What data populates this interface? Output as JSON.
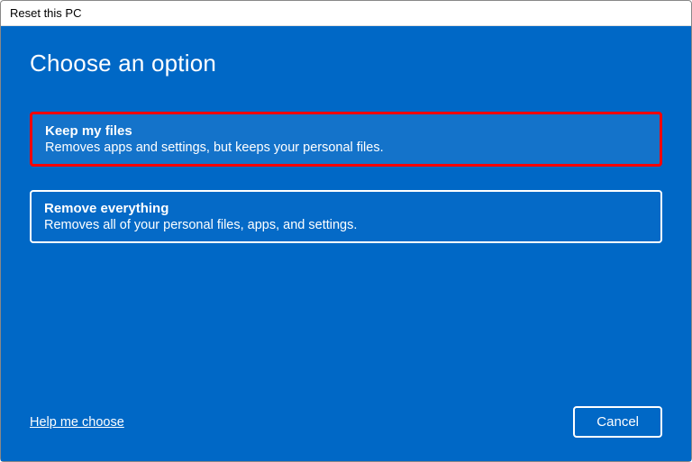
{
  "window": {
    "title": "Reset this PC"
  },
  "heading": "Choose an option",
  "options": [
    {
      "title": "Keep my files",
      "description": "Removes apps and settings, but keeps your personal files."
    },
    {
      "title": "Remove everything",
      "description": "Removes all of your personal files, apps, and settings."
    }
  ],
  "footer": {
    "help_link": "Help me choose",
    "cancel": "Cancel"
  }
}
